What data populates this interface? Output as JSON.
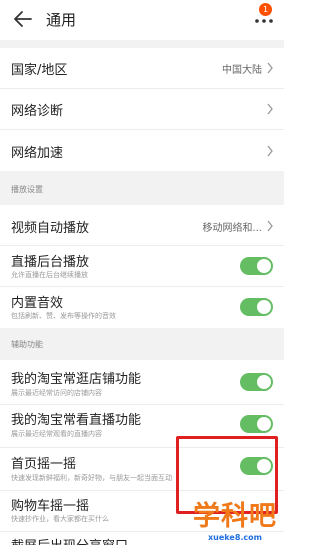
{
  "header": {
    "back_icon": "arrow-left-icon",
    "title": "通用",
    "more_icon": "more-dots-icon",
    "badge": "1"
  },
  "rows_top": [
    {
      "label": "国家/地区",
      "value": "中国大陆"
    },
    {
      "label": "网络诊断"
    },
    {
      "label": "网络加速"
    }
  ],
  "playback": {
    "section_label": "播放设置",
    "autoplay": {
      "label": "视频自动播放",
      "value": "移动网络和..."
    },
    "background": {
      "label": "直播后台播放",
      "sub": "允许直播在后台继续播放",
      "enabled": true
    },
    "sound": {
      "label": "内置音效",
      "sub": "包括刷新、赞、发布等操作的音效",
      "enabled": true
    }
  },
  "assist": {
    "section_label": "辅助功能",
    "shop": {
      "label": "我的淘宝常逛店铺功能",
      "sub": "展示最近经常访问的店铺内容",
      "enabled": true
    },
    "live": {
      "label": "我的淘宝常看直播功能",
      "sub": "展示最近经常观看的直播内容",
      "enabled": true
    },
    "shake_home": {
      "label": "首页摇一摇",
      "sub": "快速发现新鲜福利，新奇好物，与朋友一起当面互动",
      "enabled": true
    },
    "shake_cart": {
      "label": "购物车摇一摇",
      "sub": "快速抄作业，看大家都在买什么"
    },
    "partial": {
      "label": "截屏后出现分享窗口"
    }
  },
  "watermark": {
    "main": "学科吧",
    "url": "xueke8.com"
  },
  "colors": {
    "toggle_on": "#64bd63",
    "badge": "#ff5000",
    "highlight": "#e02020"
  }
}
